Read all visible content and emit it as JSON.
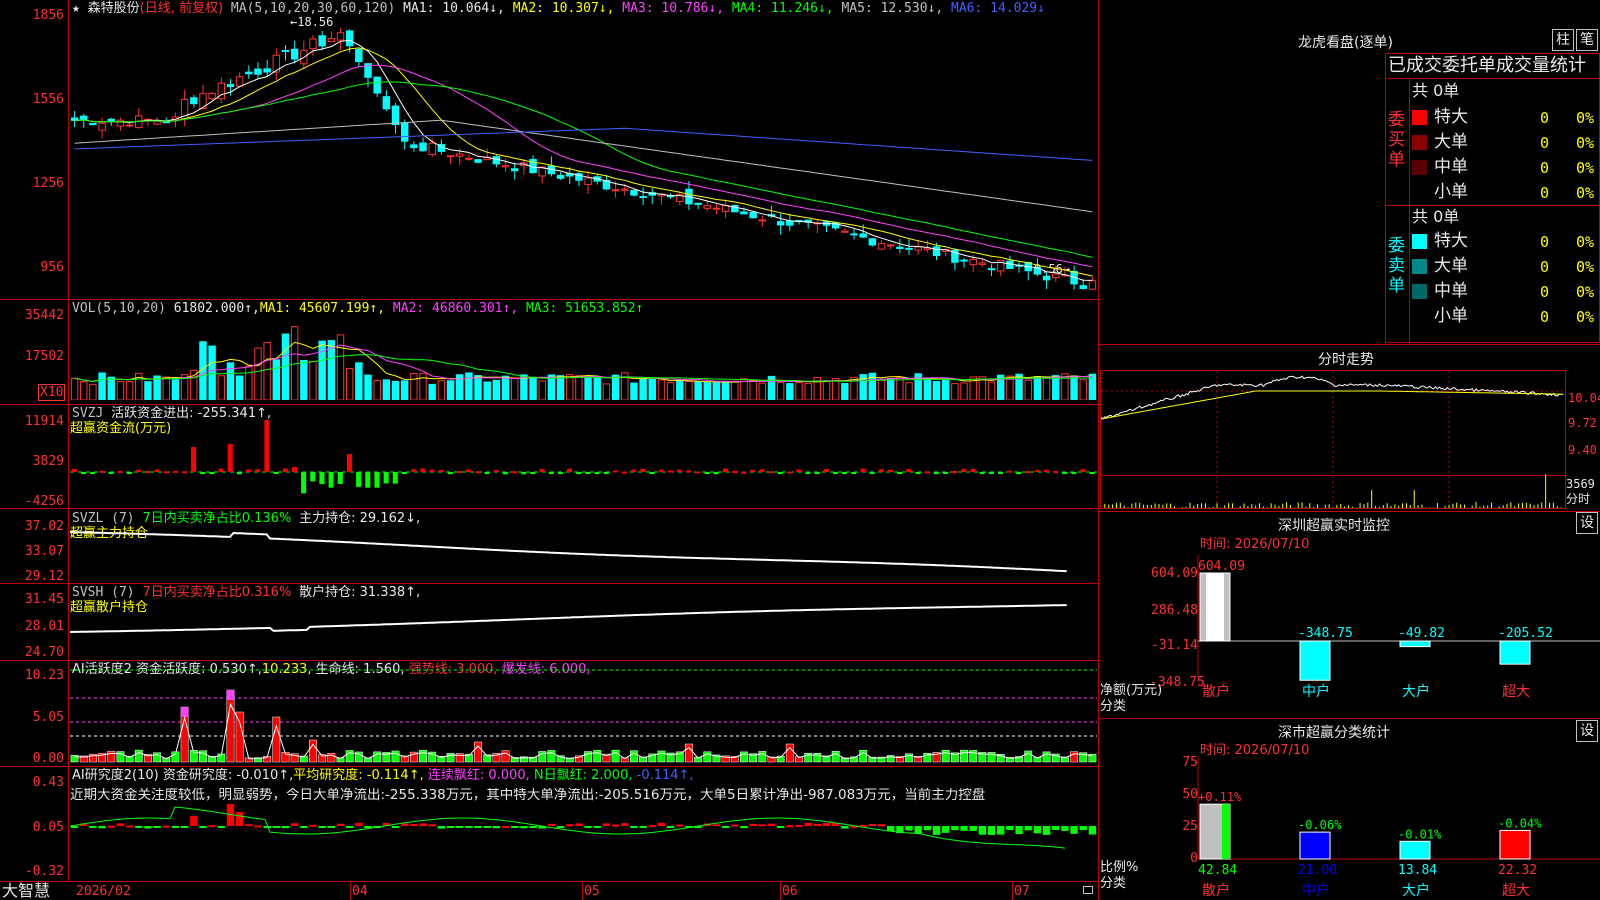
{
  "header": {
    "star": "★",
    "stock_name": "森特股份",
    "mode": "(日线, 前复权)",
    "ma_label": "MA(5,10,20,30,60,120)",
    "ma1": "MA1: 10.064↓,",
    "ma2": "MA2: 10.307↓,",
    "ma3": "MA3: 10.786↓,",
    "ma4": "MA4: 11.246↓,",
    "ma5": "MA5: 12.530↓,",
    "ma6": "MA6: 14.029↓"
  },
  "price_panel": {
    "yticks": [
      "1856",
      "1556",
      "1256",
      "956"
    ],
    "max_label": "←18.56",
    "min_label": "9.56→"
  },
  "vol_panel": {
    "label": "VOL(5,10,20)",
    "value": "61802.000↑,",
    "ma1": "MA1: 45607.199↑,",
    "ma2": "MA2: 46860.301↑,",
    "ma3": "MA3: 51653.852↑",
    "yticks": [
      "35442",
      "17502"
    ],
    "unit": "X10"
  },
  "svzj_panel": {
    "label": "SVZJ",
    "value": "活跃资金进出: -255.341↑,",
    "sub": "超赢资金流(万元)",
    "yticks": [
      "11914",
      "3829",
      "-4256"
    ]
  },
  "svzl_panel": {
    "label": "SVZL (7)",
    "desc": "7日内买卖净占比0.136%",
    "value": "主力持仓: 29.162↓,",
    "sub": "超赢主力持仓",
    "yticks": [
      "37.02",
      "33.07",
      "29.12"
    ]
  },
  "svsh_panel": {
    "label": "SVSH (7)",
    "desc": "7日内买卖净占比0.316%",
    "value": "散户持仓: 31.338↑,",
    "sub": "超赢散户持仓",
    "yticks": [
      "31.45",
      "28.01",
      "24.70"
    ]
  },
  "ai_active_panel": {
    "label": "AI活跃度2",
    "v1": "资金活跃度: 0.530↑,",
    "v2": "10.233,",
    "v3": "生命线: 1.560,",
    "v4": "强势线: 3.000,",
    "v5": "爆发线: 6.000,",
    "yticks": [
      "10.23",
      "5.05",
      "0.00"
    ]
  },
  "ai_research_panel": {
    "label": "AI研究度2(10)",
    "v1": "资金研究度: -0.010↑,",
    "v2": "平均研究度: -0.114↑,",
    "v3": "连续飘红: 0.000,",
    "v4": "N日飘红: 2.000,",
    "v5": "-0.114↑,",
    "comment": "近期大资金关注度较低，明显弱势，今日大单净流出:-255.338万元，其中特大单净流出:-205.516万元，大单5日累计净出-987.083万元，当前主力控盘",
    "yticks": [
      "0.43",
      "0.05",
      "-0.32"
    ]
  },
  "bottom_bar": {
    "brand": "大智慧",
    "dates": [
      "2026/02",
      "04",
      "05",
      "06",
      "07"
    ]
  },
  "dragon_panel": {
    "title": "龙虎看盘(逐单)",
    "btn1": "柱",
    "btn2": "笔",
    "heading": "已成交委托单成交量统计",
    "buy_label": "委买单",
    "sell_label": "委卖单",
    "buy_total": "共 0单",
    "sell_total": "共 0单",
    "buy_rows": [
      {
        "name": "特大",
        "count": "0",
        "pct": "0%",
        "color": "#ff0000"
      },
      {
        "name": "大单",
        "count": "0",
        "pct": "0%",
        "color": "#8b0000"
      },
      {
        "name": "中单",
        "count": "0",
        "pct": "0%",
        "color": "#5a0000"
      },
      {
        "name": "小单",
        "count": "0",
        "pct": "0%",
        "color": "#000000"
      }
    ],
    "sell_rows": [
      {
        "name": "特大",
        "count": "0",
        "pct": "0%",
        "color": "#00ffff"
      },
      {
        "name": "大单",
        "count": "0",
        "pct": "0%",
        "color": "#008b8b"
      },
      {
        "name": "中单",
        "count": "0",
        "pct": "0%",
        "color": "#006868"
      },
      {
        "name": "小单",
        "count": "0",
        "pct": "0%",
        "color": "#000000"
      }
    ]
  },
  "intraday_panel": {
    "title": "分时走势",
    "yticks": [
      "10.04",
      "9.72",
      "9.40"
    ],
    "vol_tick": "3569",
    "vol_unit": "分时"
  },
  "sz_monitor": {
    "title": "深圳超赢实时监控",
    "btn": "设",
    "time": "时间: 2026/07/10",
    "yticks": [
      "604.09",
      "286.48",
      "-31.14",
      "-348.75"
    ],
    "ylabel1": "净额(万元)",
    "ylabel2": "分类",
    "bars": [
      {
        "cat": "散户",
        "value": "604.09"
      },
      {
        "cat": "中户",
        "value": "-348.75"
      },
      {
        "cat": "大户",
        "value": "-49.82"
      },
      {
        "cat": "超大",
        "value": "-205.52"
      }
    ]
  },
  "sz_class": {
    "title": "深市超赢分类统计",
    "btn": "设",
    "time": "时间: 2026/07/10",
    "yticks": [
      "75",
      "50",
      "25",
      "0"
    ],
    "ylabel1": "比例%",
    "ylabel2": "分类",
    "bars": [
      {
        "cat": "散户",
        "value": "42.84",
        "change": "+0.11%"
      },
      {
        "cat": "中户",
        "value": "21.00",
        "change": "-0.06%"
      },
      {
        "cat": "大户",
        "value": "13.84",
        "change": "-0.01%"
      },
      {
        "cat": "超大",
        "value": "22.32",
        "change": "-0.04%"
      }
    ]
  }
}
